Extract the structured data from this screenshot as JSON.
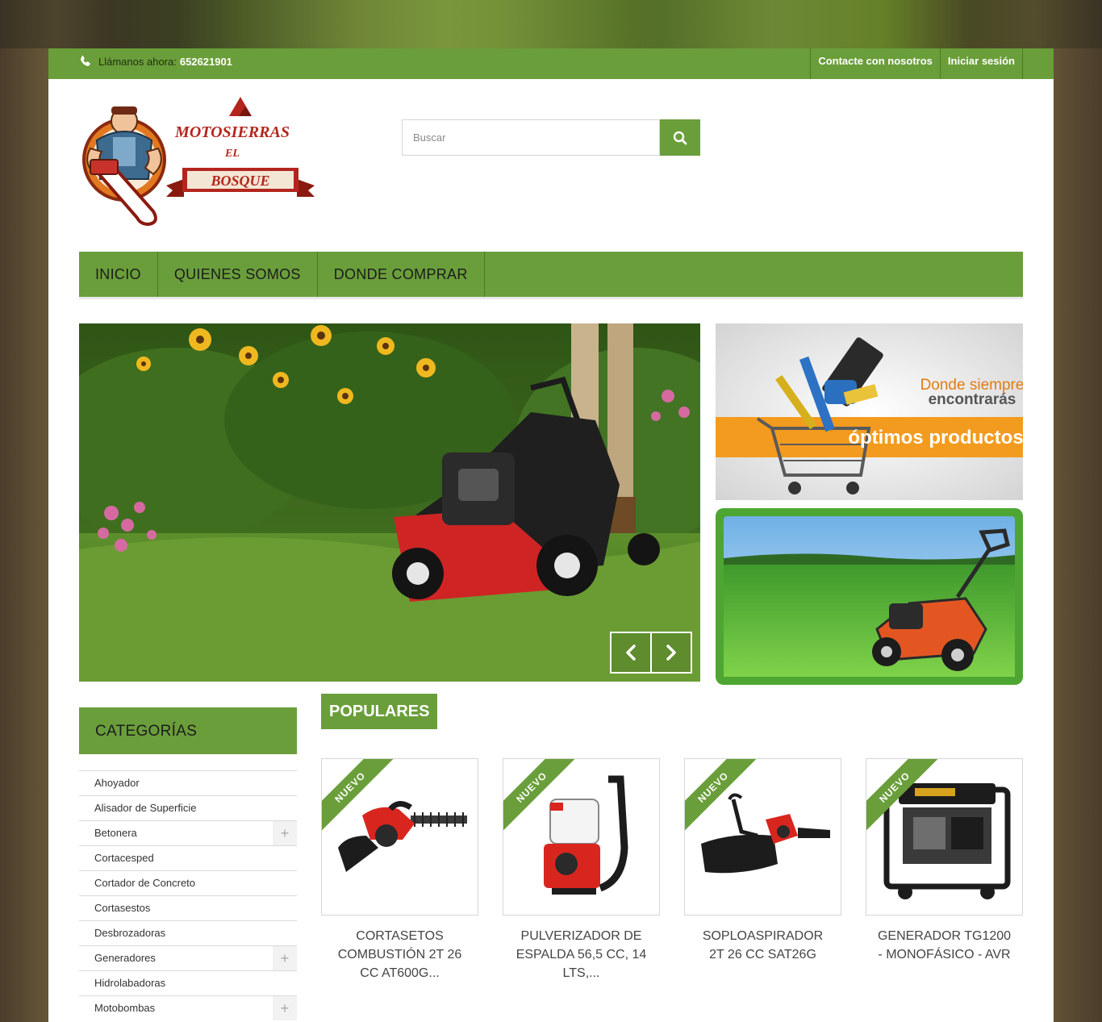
{
  "topbar": {
    "call_label": "Llámanos ahora:",
    "phone": "652621901",
    "links": [
      "Contacte con nosotros",
      "Iniciar sesión"
    ]
  },
  "logo": {
    "line1": "MOTOSIERRAS",
    "line2": "EL",
    "line3": "BOSQUE"
  },
  "search": {
    "placeholder": "Buscar",
    "icon": "search-icon"
  },
  "menu": [
    "INICIO",
    "QUIENES SOMOS",
    "DONDE COMPRAR"
  ],
  "banner1": {
    "line1": "Donde siempre",
    "line2": "encontrarás",
    "line3": "óptimos productos"
  },
  "categories": {
    "title": "CATEGORÍAS",
    "items": [
      {
        "label": "Ahoyador",
        "expandable": false
      },
      {
        "label": "Alisador de Superficie",
        "expandable": false
      },
      {
        "label": "Betonera",
        "expandable": true
      },
      {
        "label": "Cortacesped",
        "expandable": false
      },
      {
        "label": "Cortador de Concreto",
        "expandable": false
      },
      {
        "label": "Cortasestos",
        "expandable": false
      },
      {
        "label": "Desbrozadoras",
        "expandable": false
      },
      {
        "label": "Generadores",
        "expandable": true
      },
      {
        "label": "Hidrolabadoras",
        "expandable": false
      },
      {
        "label": "Motobombas",
        "expandable": true
      }
    ]
  },
  "popular": {
    "title": "POPULARES",
    "badge": "NUEVO",
    "products": [
      {
        "name": "CORTASETOS COMBUSTIÓN 2T 26 CC AT600G..."
      },
      {
        "name": "PULVERIZADOR DE ESPALDA 56,5 CC, 14 LTS,..."
      },
      {
        "name": "SOPLOASPIRADOR 2T 26 CC SAT26G"
      },
      {
        "name": "GENERADOR TG1200 - MONOFÁSICO - AVR"
      }
    ]
  },
  "colors": {
    "accent": "#6a9e3a"
  }
}
